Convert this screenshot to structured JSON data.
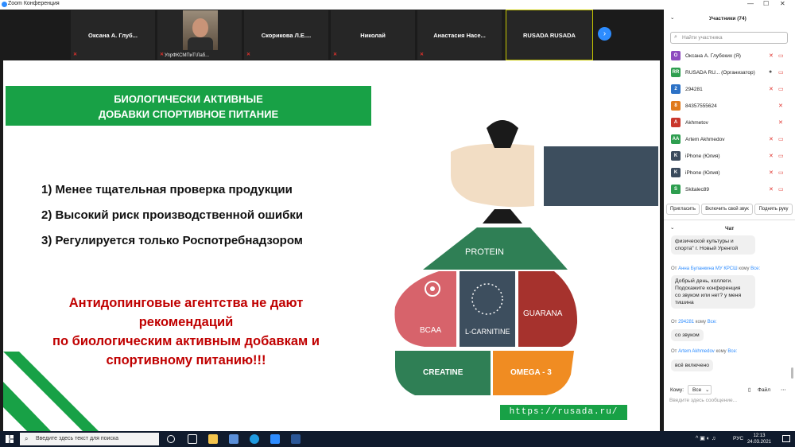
{
  "app": {
    "title": "Zoom Конференция"
  },
  "participants_strip": [
    {
      "name": "Оксана  А.  Глуб...",
      "sub": ""
    },
    {
      "name": "",
      "sub": "УпрФКСМПиТ\\Лаб..."
    },
    {
      "name": "Скорикова  Л.Е....",
      "sub": ""
    },
    {
      "name": "Николай",
      "sub": ""
    },
    {
      "name": "Анастасия  Насе...",
      "sub": ""
    },
    {
      "name": "RUSADA RUSADA",
      "sub": ""
    }
  ],
  "slide": {
    "banner_line1": "БИОЛОГИЧЕСКИ АКТИВНЫЕ",
    "banner_line2": "ДОБАВКИ СПОРТИВНОЕ ПИТАНИЕ",
    "item1": "1)  Менее тщательная проверка продукции",
    "item2": "2)  Высокий риск производственной ошибки",
    "item3": "3)  Регулируется только Роспотребнадзором",
    "red1": "Антидопинговые агентства не дают",
    "red2": "рекомендаций",
    "red3": "по биологическим активным добавкам и",
    "red4": "спортивному питанию!!!",
    "bag_protein": "PROTEIN",
    "bag_bcaa": "BCAA",
    "bag_lcarnitine": "L-CARNITINE",
    "bag_guarana": "GUARANA",
    "bag_creatine": "CREATINE",
    "bag_omega": "OMEGA - 3",
    "url": "https://rusada.ru/"
  },
  "panel": {
    "participants_title": "Участники (74)",
    "search_placeholder": "Найти участника",
    "participants": [
      {
        "initials": "О",
        "name": "Оксана А. Глубоких (Я)",
        "color": "#8e4bbf"
      },
      {
        "initials": "RR",
        "name": "RUSADA RU...  (Организатор)",
        "color": "#2e9e4f"
      },
      {
        "initials": "2",
        "name": "294281",
        "color": "#2d72c6"
      },
      {
        "initials": "8",
        "name": "84357555624",
        "color": "#e07a1c"
      },
      {
        "initials": "A",
        "name": "Akhmetov",
        "color": "#c9372c"
      },
      {
        "initials": "AA",
        "name": "Artem Akhmedov",
        "color": "#2e9e4f"
      },
      {
        "initials": "K",
        "name": "iPhone (Юлия)",
        "color": "#3a4a5c"
      },
      {
        "initials": "K",
        "name": "iPhone (Юлия)",
        "color": "#3a4a5c"
      },
      {
        "initials": "S",
        "name": "Skitalec89",
        "color": "#2e9e4f"
      }
    ],
    "btn_invite": "Пригласить",
    "btn_unmute": "Включить свой звук",
    "btn_hand": "Поднять руку",
    "chat_title": "Чат",
    "msg0_l1": "физической культуры и",
    "msg0_l2": "спорта\" г. Новый Уренгой",
    "msg1_from": "Анна Буланкина МУ КРСШ",
    "msg1_to": "Все:",
    "msg1_l1": "Добрый день, коллеги.",
    "msg1_l2": "Подскажите конференция",
    "msg1_l3": "со звуком или нет? у меня",
    "msg1_l4": "тишина",
    "msg2_from": "294281",
    "msg2_to": "Все:",
    "msg2_text": "со звуком",
    "msg3_from": "Artem Akhmedov",
    "msg3_to": "Все:",
    "msg3_text": "всё включено",
    "from_word": "От",
    "to_word": "кому",
    "to_label": "Кому:",
    "to_value": "Все",
    "file_label": "Файл",
    "input_placeholder": "Введите здесь сообщение..."
  },
  "taskbar": {
    "search_placeholder": "Введите здесь текст для поиска",
    "lang": "РУС",
    "time": "12:13",
    "date": "24.03.2021"
  }
}
